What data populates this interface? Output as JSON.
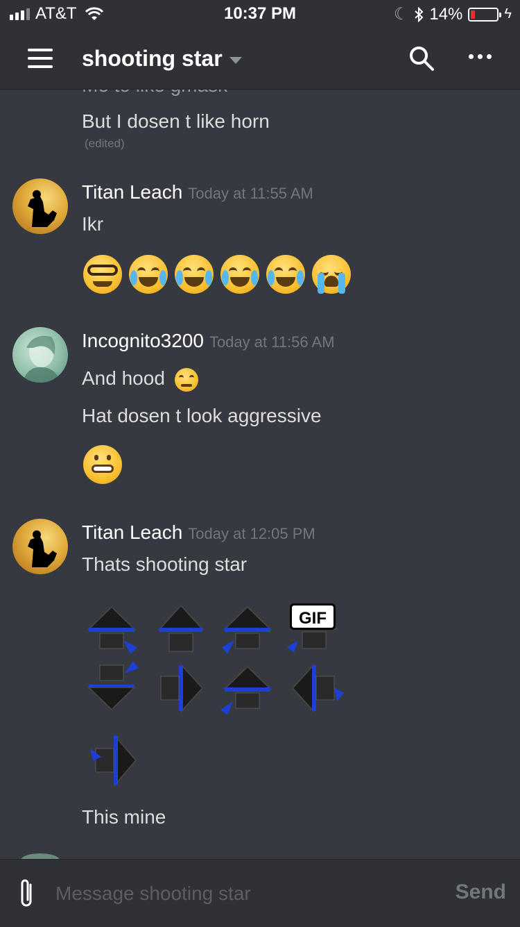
{
  "status_bar": {
    "carrier": "AT&T",
    "time": "10:37 PM",
    "battery_percent": "14%",
    "battery_level": 0.14
  },
  "header": {
    "channel_name": "shooting star",
    "icons": [
      "menu-icon",
      "search-icon",
      "more-icon"
    ]
  },
  "messages": {
    "clipped_line": "Me to like gmask",
    "line_horn": "But I dosen t like horn",
    "edited_label": "(edited)",
    "group1": {
      "username": "Titan Leach",
      "timestamp": "Today at 11:55 AM",
      "text": "Ikr",
      "emojis": [
        "nerd-face",
        "tears-of-joy",
        "tears-of-joy",
        "tears-of-joy",
        "tears-of-joy",
        "loudly-crying"
      ]
    },
    "group2": {
      "username": "Incognito3200",
      "timestamp": "Today at 11:56 AM",
      "text1": "And hood",
      "text1_emoji": "confounded-face",
      "text2": "Hat dosen t look aggressive",
      "emoji": "grimacing-face"
    },
    "group3": {
      "username": "Titan Leach",
      "timestamp": "Today at 12:05 PM",
      "text1": "Thats shooting star",
      "gif_label": "GIF",
      "text2": "This mine"
    }
  },
  "composer": {
    "placeholder": "Message shooting star",
    "send_label": "Send"
  },
  "colors": {
    "background": "#36393f",
    "header": "#2f3136",
    "text": "#dcddde",
    "muted": "#72767d",
    "battery_low": "#e8302a"
  }
}
